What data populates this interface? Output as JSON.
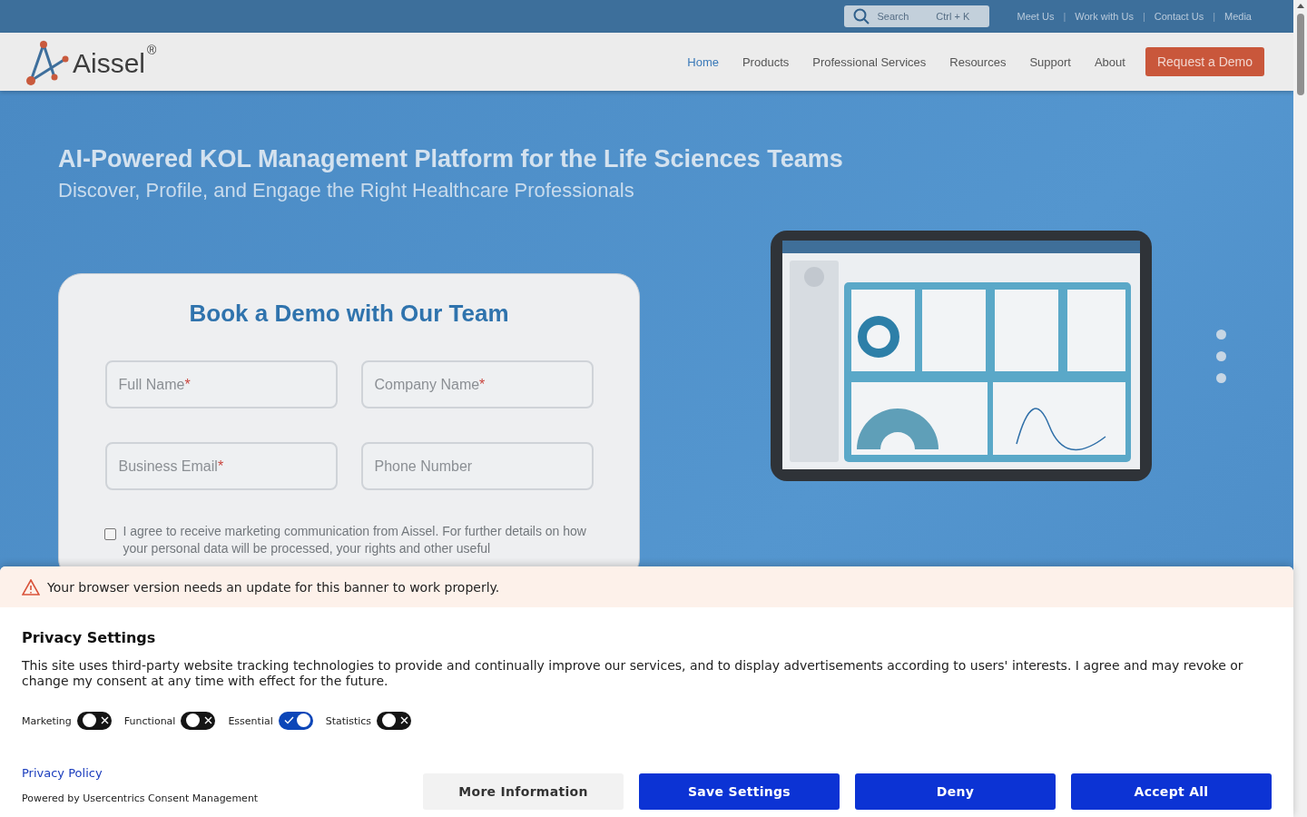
{
  "top_bar": {
    "search": {
      "placeholder": "Search",
      "shortcut": "Ctrl + K"
    },
    "links": [
      {
        "label": "Meet Us"
      },
      {
        "label": "Work with Us"
      },
      {
        "label": "Contact Us"
      },
      {
        "label": "Media"
      }
    ],
    "separator": "|"
  },
  "nav": {
    "logo": {
      "text": "Aissel",
      "mark": "®"
    },
    "items": [
      {
        "label": "Home",
        "selected": true
      },
      {
        "label": "Products",
        "selected": false
      },
      {
        "label": "Professional Services",
        "selected": false
      },
      {
        "label": "Resources",
        "selected": false
      },
      {
        "label": "Support",
        "selected": false
      },
      {
        "label": "About",
        "selected": false
      }
    ],
    "cta": "Request a Demo"
  },
  "hero": {
    "title": "AI-Powered KOL Management Platform for the Life Sciences Teams",
    "subtitle": "Discover, Profile, and Engage the Right Healthcare Professionals",
    "form": {
      "title": "Book a Demo with Our Team",
      "fields": [
        {
          "placeholder": "Full Name",
          "required_mark": "*"
        },
        {
          "placeholder": "Company Name",
          "required_mark": "*"
        },
        {
          "placeholder": "Business Email",
          "required_mark": "*"
        },
        {
          "placeholder": "Phone Number"
        }
      ],
      "consent": {
        "checked": false,
        "text": "I agree to receive marketing communication from Aissel. For further details on how your personal data will be processed, your rights and other useful"
      }
    },
    "carousel_dots": [
      {
        "selected": false
      },
      {
        "selected": false
      },
      {
        "selected": false
      }
    ]
  },
  "privacy_banner": {
    "warning": "Your browser version needs an update for this banner to work properly.",
    "title": "Privacy Settings",
    "text": "This site uses third-party website tracking technologies to provide and continually improve our services, and to display advertisements according to users' interests. I agree and may revoke or change my consent at any time with effect for the future.",
    "toggles": [
      {
        "label": "Marketing",
        "on": false
      },
      {
        "label": "Functional",
        "on": false
      },
      {
        "label": "Essential",
        "on": true
      },
      {
        "label": "Statistics",
        "on": false
      }
    ],
    "privacy_link": "Privacy Policy",
    "powered_by": "Powered by Usercentrics Consent Management",
    "buttons": [
      {
        "label": "More Information",
        "kind": "secondary"
      },
      {
        "label": "Save Settings",
        "kind": "primary"
      },
      {
        "label": "Deny",
        "kind": "primary"
      },
      {
        "label": "Accept All",
        "kind": "primary"
      }
    ]
  }
}
